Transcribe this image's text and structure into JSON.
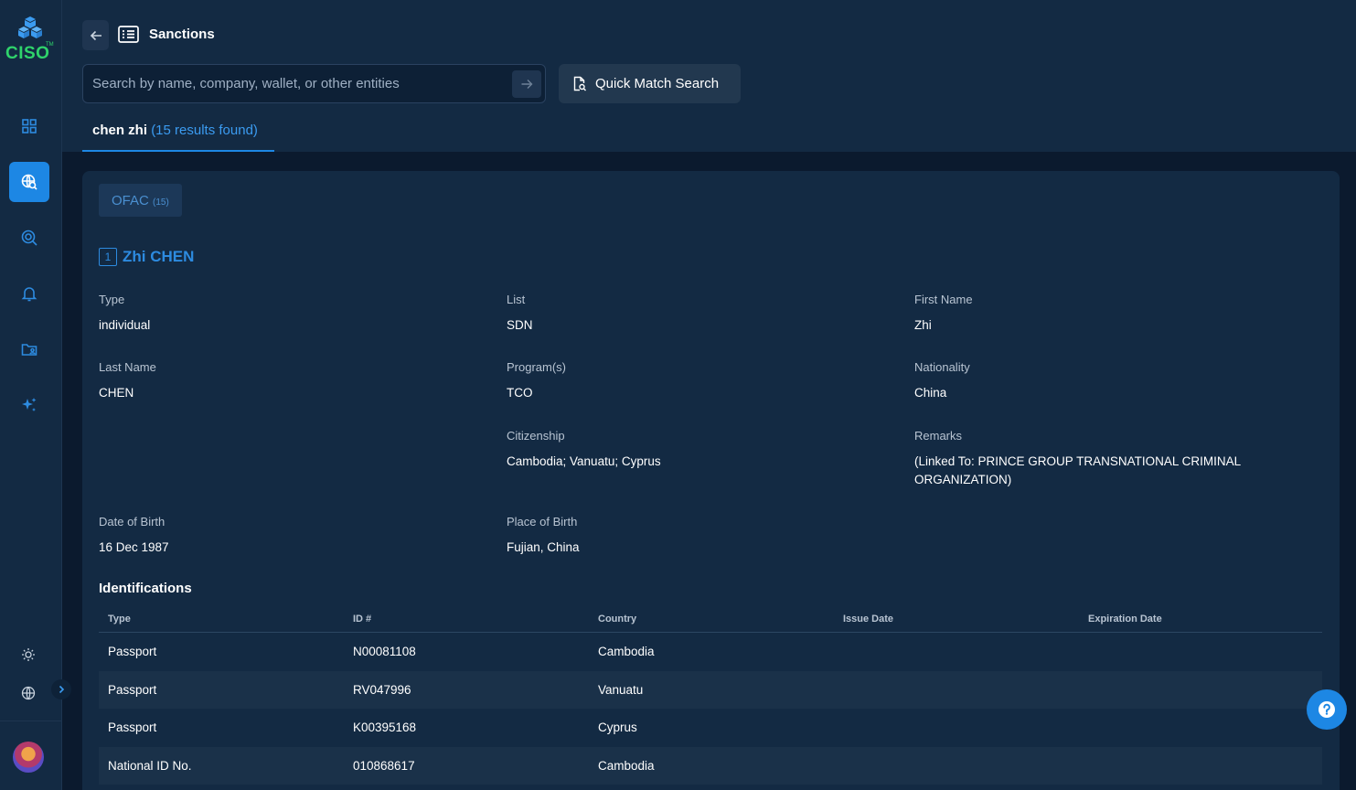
{
  "app": {
    "logo_text": "CISO",
    "logo_tm": "TM"
  },
  "sidebar": {
    "items": [
      {
        "name": "dashboard",
        "icon": "grid-icon"
      },
      {
        "name": "sanctions",
        "icon": "globe-search-icon",
        "active": true
      },
      {
        "name": "investigations",
        "icon": "target-search-icon"
      },
      {
        "name": "alerts",
        "icon": "bell-icon"
      },
      {
        "name": "cases",
        "icon": "folder-user-icon"
      },
      {
        "name": "ai",
        "icon": "sparkle-icon"
      }
    ],
    "bottom": [
      "sun-icon",
      "globe-icon"
    ]
  },
  "header": {
    "title": "Sanctions",
    "search_placeholder": "Search by name, company, wallet, or other entities",
    "quick_match_label": "Quick Match Search",
    "result_query": "chen zhi",
    "result_count": "(15 results found)"
  },
  "source": {
    "label": "OFAC",
    "count": "(15)"
  },
  "record": {
    "number": "1",
    "name": "Zhi CHEN",
    "fields": {
      "type": {
        "label": "Type",
        "value": "individual"
      },
      "list": {
        "label": "List",
        "value": "SDN"
      },
      "first_name": {
        "label": "First Name",
        "value": "Zhi"
      },
      "last_name": {
        "label": "Last Name",
        "value": "CHEN"
      },
      "programs": {
        "label": "Program(s)",
        "value": "TCO"
      },
      "nationality": {
        "label": "Nationality",
        "value": "China"
      },
      "citizenship": {
        "label": "Citizenship",
        "value": "Cambodia; Vanuatu; Cyprus"
      },
      "remarks": {
        "label": "Remarks",
        "value": "(Linked To: PRINCE GROUP TRANSNATIONAL CRIMINAL ORGANIZATION)"
      },
      "dob": {
        "label": "Date of Birth",
        "value": "16 Dec 1987"
      },
      "pob": {
        "label": "Place of Birth",
        "value": "Fujian, China"
      }
    }
  },
  "identifications": {
    "title": "Identifications",
    "columns": [
      "Type",
      "ID #",
      "Country",
      "Issue Date",
      "Expiration Date"
    ],
    "rows": [
      [
        "Passport",
        "N00081108",
        "Cambodia",
        "",
        ""
      ],
      [
        "Passport",
        "RV047996",
        "Vanuatu",
        "",
        ""
      ],
      [
        "Passport",
        "K00395168",
        "Cyprus",
        "",
        ""
      ],
      [
        "National ID No.",
        "010868617",
        "Cambodia",
        "",
        ""
      ]
    ]
  },
  "colors": {
    "accent": "#1d87e4",
    "background": "#0b1a2e",
    "panel": "#132a43",
    "logo_green": "#2fd36b"
  }
}
